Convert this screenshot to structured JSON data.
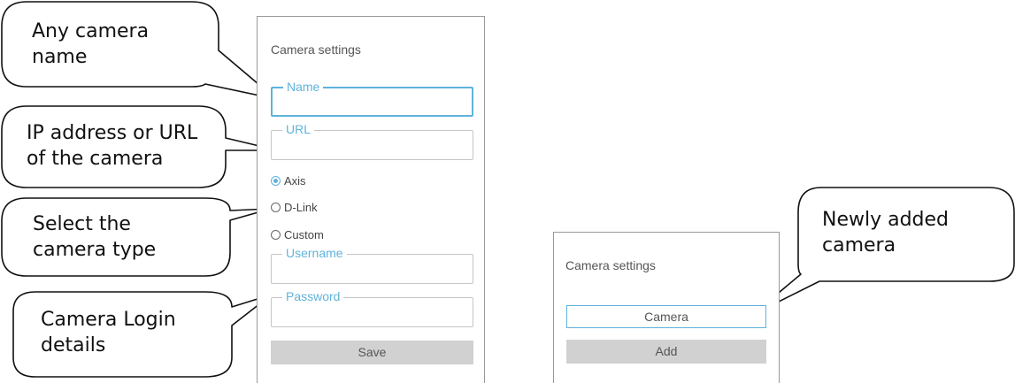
{
  "callouts": {
    "name": "Any camera\nname",
    "url": "IP address or URL\nof the camera",
    "type": "Select the\ncamera type",
    "login": "Camera Login\ndetails",
    "added": "Newly added\ncamera"
  },
  "settings_form": {
    "title": "Camera settings",
    "name_legend": "Name",
    "url_legend": "URL",
    "camera_types": [
      "Axis",
      "D-Link",
      "Custom"
    ],
    "selected_type": "Axis",
    "username_legend": "Username",
    "password_legend": "Password",
    "save_label": "Save"
  },
  "camera_list": {
    "title": "Camera settings",
    "cameras": [
      "Camera"
    ],
    "add_label": "Add"
  },
  "colors": {
    "accent": "#5fb3dc",
    "button_bg": "#d1d1d1",
    "callout_stroke": "#111111"
  }
}
